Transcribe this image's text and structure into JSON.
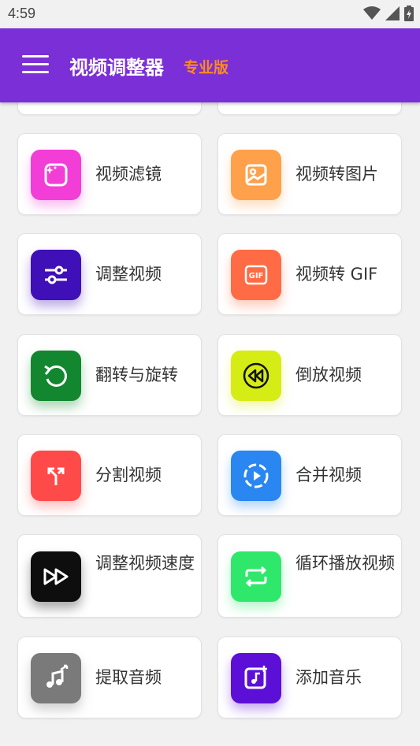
{
  "status_bar": {
    "time": "4:59",
    "icons": [
      "wifi-icon",
      "signal-icon",
      "battery-icon"
    ]
  },
  "app_bar": {
    "title": "视频调整器",
    "subtitle": "专业版",
    "title_color": "#ffffff",
    "subtitle_color": "#ff8a1e",
    "background": "#7b2fd6",
    "menu_icon": "hamburger-menu-icon"
  },
  "tools": [
    {
      "label": "视频滤镜",
      "icon": "sparkle-frame-icon",
      "color": "#f23dd7"
    },
    {
      "label": "视频转图片",
      "icon": "image-icon",
      "color": "#ffa04a"
    },
    {
      "label": "调整视频",
      "icon": "sliders-icon",
      "color": "#3f0fb7"
    },
    {
      "label": "视频转 GIF",
      "icon": "gif-icon",
      "color": "#ff6b44"
    },
    {
      "label": "翻转与旋转",
      "icon": "rotate-icon",
      "color": "#12872f"
    },
    {
      "label": "倒放视频",
      "icon": "rewind-icon",
      "color": "#d6ec15"
    },
    {
      "label": "分割视频",
      "icon": "split-icon",
      "color": "#ff4a4a"
    },
    {
      "label": "合并视频",
      "icon": "merge-play-icon",
      "color": "#2a86f0"
    },
    {
      "label": "调整视频速度",
      "icon": "fast-forward-icon",
      "color": "#0e0e0e"
    },
    {
      "label": "循环播放视频",
      "icon": "loop-icon",
      "color": "#2fe86b"
    },
    {
      "label": "提取音频",
      "icon": "music-extract-icon",
      "color": "#7a7a7a"
    },
    {
      "label": "添加音乐",
      "icon": "add-music-icon",
      "color": "#5c0fd6"
    }
  ]
}
